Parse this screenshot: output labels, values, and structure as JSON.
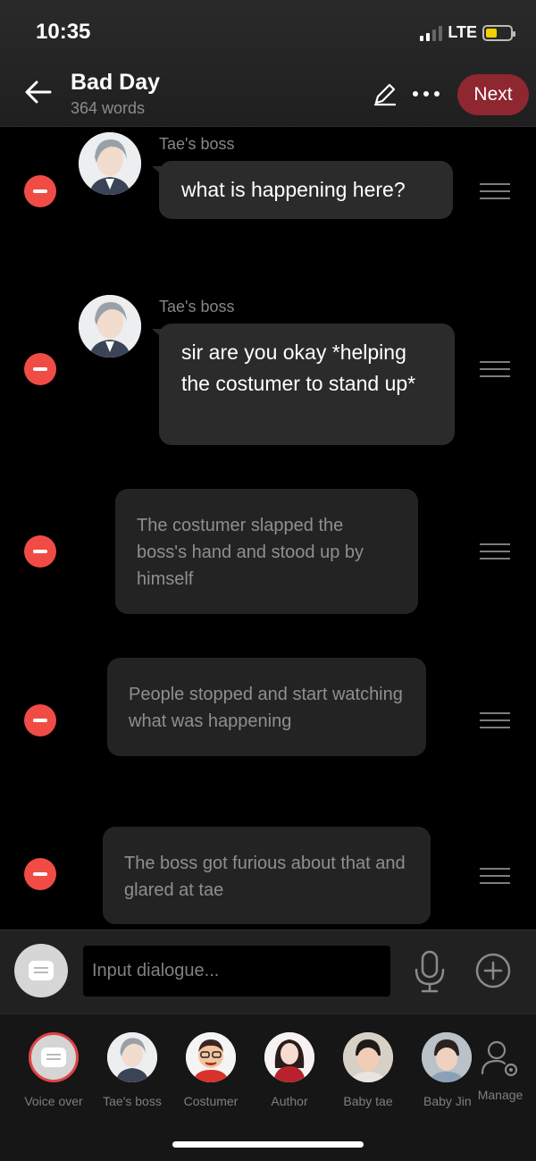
{
  "status_bar": {
    "time": "10:35",
    "network": "LTE"
  },
  "header": {
    "title": "Bad Day",
    "word_count": "364 words",
    "next_label": "Next"
  },
  "messages": [
    {
      "speaker": "Tae's boss",
      "text": "what is happening here?",
      "type": "dialogue"
    },
    {
      "speaker": "Tae's boss",
      "text": "sir are you okay *helping the costumer to stand up*",
      "type": "dialogue"
    },
    {
      "text": "The costumer slapped the boss's hand and stood up by himself",
      "type": "narration"
    },
    {
      "text": "People stopped and start watching what was happening",
      "type": "narration"
    },
    {
      "text": "The boss got furious about that and glared at tae",
      "type": "narration"
    }
  ],
  "input": {
    "placeholder": "Input dialogue..."
  },
  "characters": [
    {
      "label": "Voice over"
    },
    {
      "label": "Tae's boss"
    },
    {
      "label": "Costumer"
    },
    {
      "label": "Author"
    },
    {
      "label": "Baby tae"
    },
    {
      "label": "Baby Jin"
    },
    {
      "label": "Manage"
    }
  ],
  "colors": {
    "accent": "#8e2730",
    "remove": "#f04c45",
    "bubble": "#2b2b2b",
    "narration": "#232323"
  }
}
